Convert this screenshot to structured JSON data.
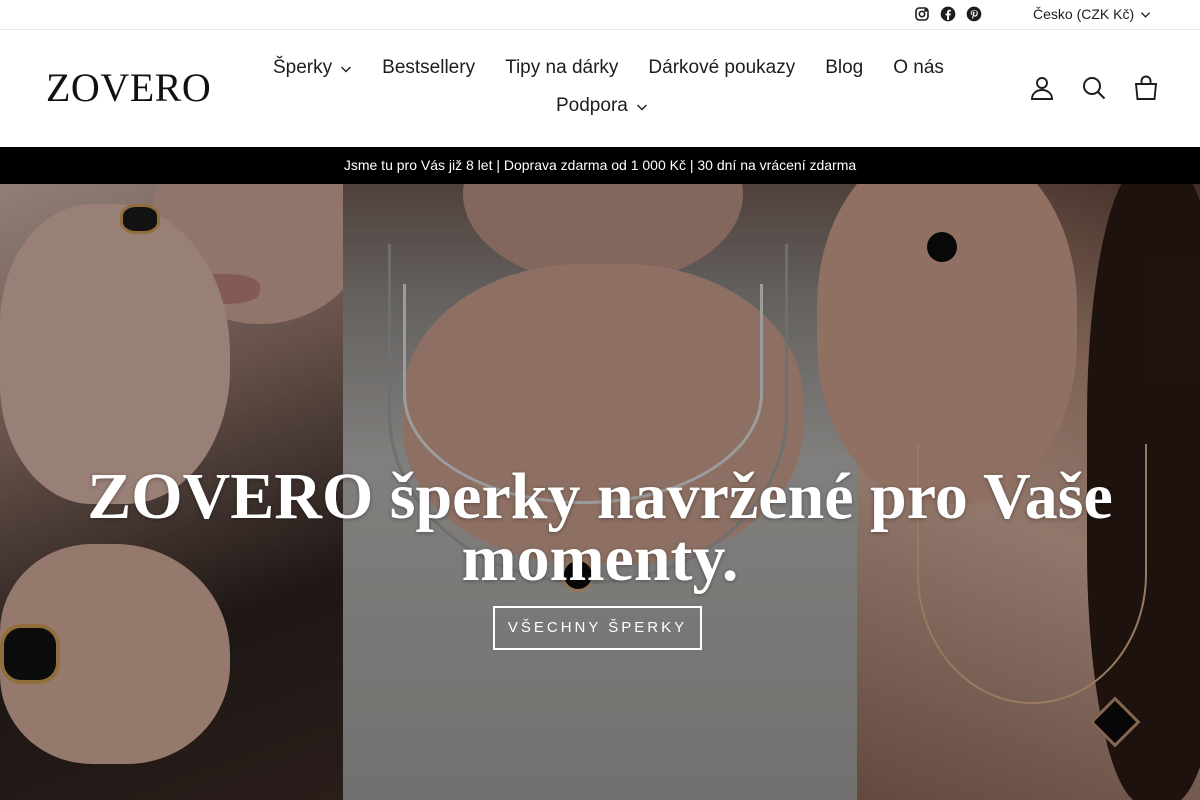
{
  "utility": {
    "social": [
      {
        "name": "instagram-icon"
      },
      {
        "name": "facebook-icon"
      },
      {
        "name": "pinterest-icon"
      }
    ],
    "currency_label": "Česko (CZK Kč)"
  },
  "header": {
    "logo": "ZOVERO",
    "nav": {
      "sperky": "Šperky",
      "bestsellery": "Bestsellery",
      "tipy": "Tipy na dárky",
      "poukazy": "Dárkové poukazy",
      "blog": "Blog",
      "onas": "O nás",
      "podpora": "Podpora"
    },
    "icons": [
      "account-icon",
      "search-icon",
      "cart-icon"
    ]
  },
  "announcement": "Jsme tu pro Vás již 8 let | Doprava zdarma od 1 000 Kč | 30 dní na vrácení zdarma",
  "hero": {
    "title": "ZOVERO šperky navržené pro Vaše momenty.",
    "cta": "VŠECHNY ŠPERKY"
  },
  "colors": {
    "text": "#1c1d1d",
    "announcement_bg": "#000000",
    "hero_text": "#ffffff"
  }
}
